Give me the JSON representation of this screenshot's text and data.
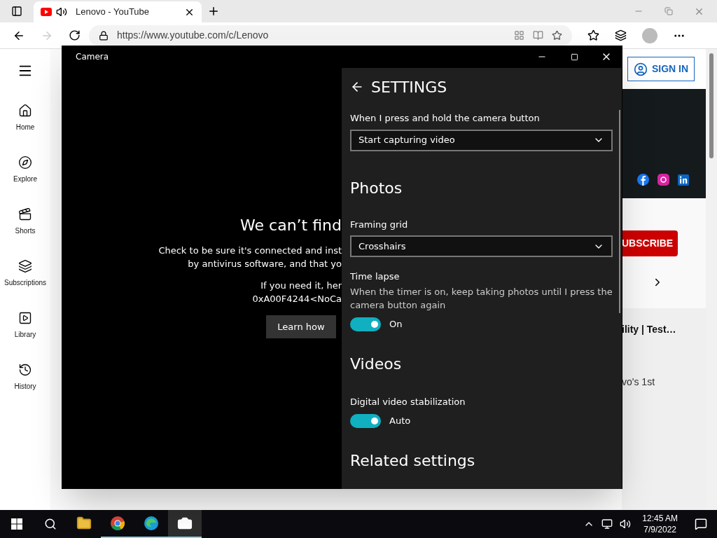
{
  "browser": {
    "tab": {
      "title": "Lenovo - YouTube",
      "selected": true
    },
    "url": "https://www.youtube.com/c/Lenovo"
  },
  "youtube": {
    "nav": [
      {
        "label": "Home",
        "kind": "home"
      },
      {
        "label": "Explore",
        "kind": "explore"
      },
      {
        "label": "Shorts",
        "kind": "shorts"
      },
      {
        "label": "Subscriptions",
        "kind": "subscriptions"
      },
      {
        "label": "Library",
        "kind": "library"
      },
      {
        "label": "History",
        "kind": "history"
      }
    ],
    "sign_in": "SIGN IN",
    "subscribe": "UBSCRIBE",
    "video_title": "ility | Test…",
    "video_desc": "vo's 1st"
  },
  "camera": {
    "title": "Camera",
    "error": {
      "heading": "We can’t find",
      "lines": [
        "Check to be sure it's connected and inst",
        "by antivirus software, and that yo"
      ],
      "code_lines": [
        "If you need it, her",
        "0xA00F4244<NoCa"
      ],
      "button": "Learn how"
    },
    "settings": {
      "title": "SETTINGS",
      "items": [
        {
          "kind": "dropdown",
          "label": "When I press and hold the camera button",
          "value": "Start capturing video"
        },
        {
          "kind": "heading",
          "label": "Photos"
        },
        {
          "kind": "dropdown",
          "label": "Framing grid",
          "value": "Crosshairs"
        },
        {
          "kind": "toggle",
          "label": "Time lapse",
          "description": "When the timer is on, keep taking photos until I press the camera button again",
          "on": true,
          "value": "On"
        },
        {
          "kind": "heading",
          "label": "Videos"
        },
        {
          "kind": "toggle",
          "label": "Digital video stabilization",
          "on": true,
          "value": "Auto"
        },
        {
          "kind": "heading",
          "label": "Related settings"
        }
      ]
    }
  },
  "taskbar": {
    "apps": [
      {
        "kind": "folder",
        "running": false,
        "selected": false
      },
      {
        "kind": "chrome",
        "running": true,
        "selected": false
      },
      {
        "kind": "edge",
        "running": true,
        "selected": false
      },
      {
        "kind": "camera",
        "running": true,
        "selected": true
      }
    ],
    "time": "12:45 AM",
    "date": "7/9/2022"
  }
}
